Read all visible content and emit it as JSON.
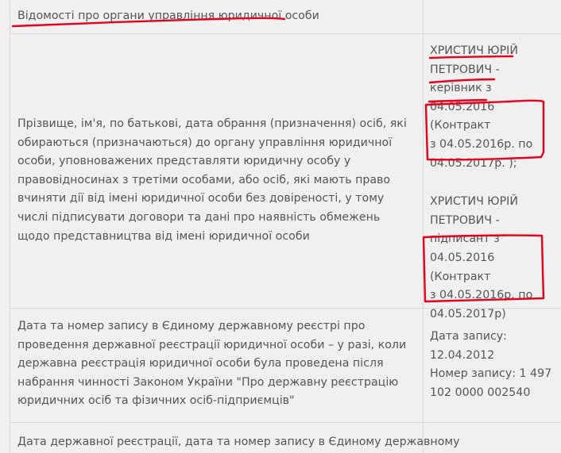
{
  "header": {
    "title": "Відомості про органи управління юридичної особи"
  },
  "rows": [
    {
      "label": "Прізвище, ім'я, по батькові, дата обрання (призначення) осіб, які обираються (призначаються) до органу управління юридичної особи, уповноважених представляти юридичну особу у правовідносинах з третіми особами, або осіб, які мають право вчиняти дії від імені юридичної особи без довіреності, у тому числі підписувати договори та дані про наявність обмежень щодо представництва від імені юридичної особи",
      "value_lines": [
        "ХРИСТИЧ ЮРІЙ",
        "ПЕТРОВИЧ -",
        "керівник з",
        "04.05.2016 (Контракт",
        "з 04.05.2016р. по",
        "04.05.2017р. );",
        "",
        "ХРИСТИЧ ЮРІЙ",
        "ПЕТРОВИЧ -",
        "підписант з",
        "04.05.2016 (Контракт",
        "з 04.05.2016р. по",
        "04.05.2017р)"
      ]
    },
    {
      "label": "Дата та номер запису в Єдиному державному реєстрі про проведення державної реєстрації юридичної особи – у разі, коли державна реєстрація юридичної особи була проведена після набрання чинності Законом України \"Про державну реєстрацію юридичних осіб та фізичних осіб-підприємців\"",
      "value_lines": [
        "Дата запису:",
        "12.04.2012",
        "Номер запису: 1 497",
        "102 0000 002540"
      ]
    },
    {
      "label": "Дата державної реєстрації, дата та номер запису в Єдиному державному",
      "value_lines": []
    }
  ],
  "annotation_color": "#e8001c"
}
